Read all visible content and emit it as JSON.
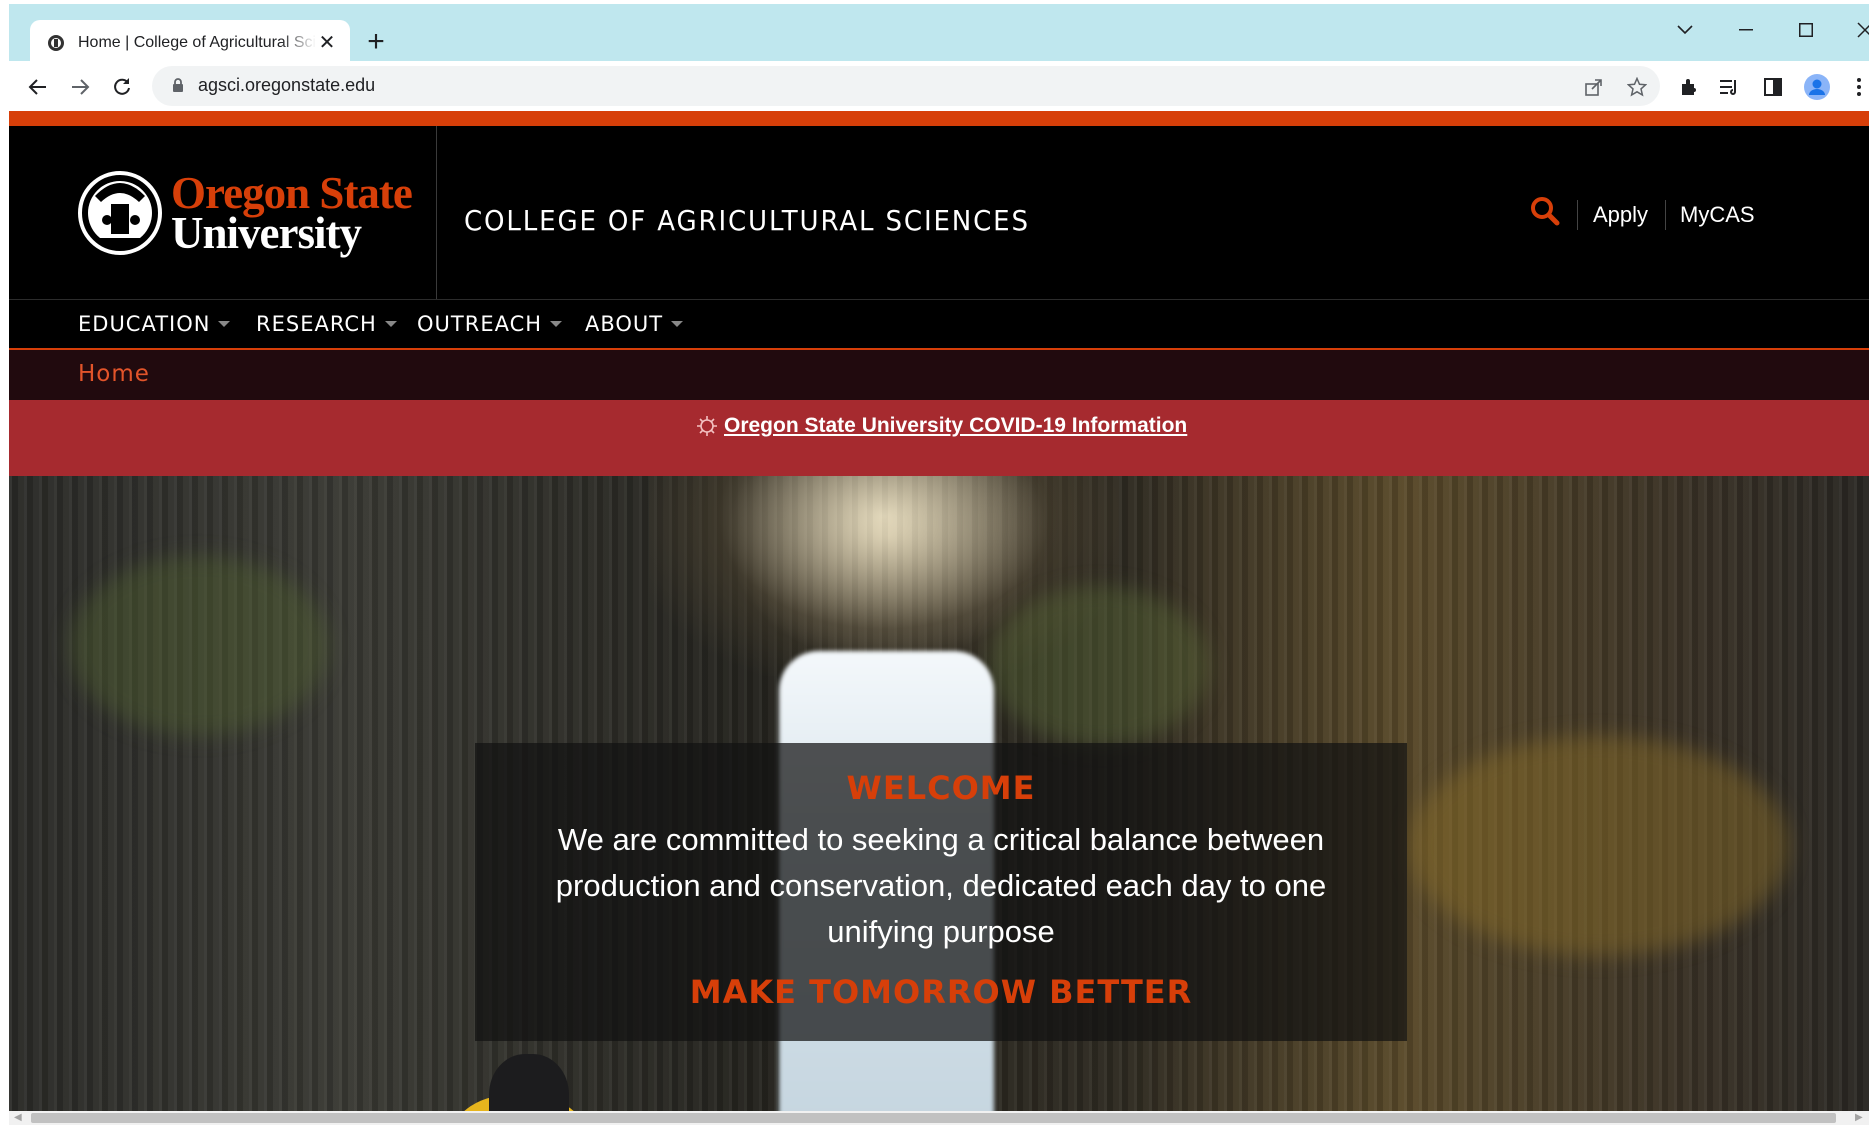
{
  "browser": {
    "tab_title": "Home | College of Agricultural Sciences",
    "new_tab_symbol": "+",
    "close_symbol": "✕",
    "url": "agsci.oregonstate.edu",
    "icons": [
      "back-arrow-icon",
      "forward-arrow-icon",
      "reload-icon",
      "lock-icon",
      "share-icon",
      "star-icon",
      "extensions-icon",
      "reading-list-icon",
      "side-panel-icon",
      "profile-icon",
      "menu-icon",
      "minimize-icon",
      "maximize-icon",
      "close-icon",
      "tab-search-icon"
    ]
  },
  "site": {
    "brand_colors": {
      "orange": "#d73f09",
      "black": "#000000",
      "covid_red": "#a62a2f",
      "breadcrumb_bg": "#210a0e"
    },
    "logo": {
      "line1": "Oregon State",
      "line2": "University"
    },
    "college_name": "COLLEGE OF AGRICULTURAL SCIENCES",
    "utility": {
      "apply": "Apply",
      "mycas": "MyCAS"
    },
    "nav": [
      {
        "label": "EDUCATION"
      },
      {
        "label": "RESEARCH"
      },
      {
        "label": "OUTREACH"
      },
      {
        "label": "ABOUT"
      }
    ],
    "breadcrumb": "Home",
    "covid_link": "Oregon State University COVID-19 Information",
    "hero": {
      "title": "WELCOME",
      "text": "We are committed to seeking a critical balance between production and conservation, dedicated each day to one unifying purpose",
      "tagline": "MAKE TOMORROW BETTER"
    }
  }
}
